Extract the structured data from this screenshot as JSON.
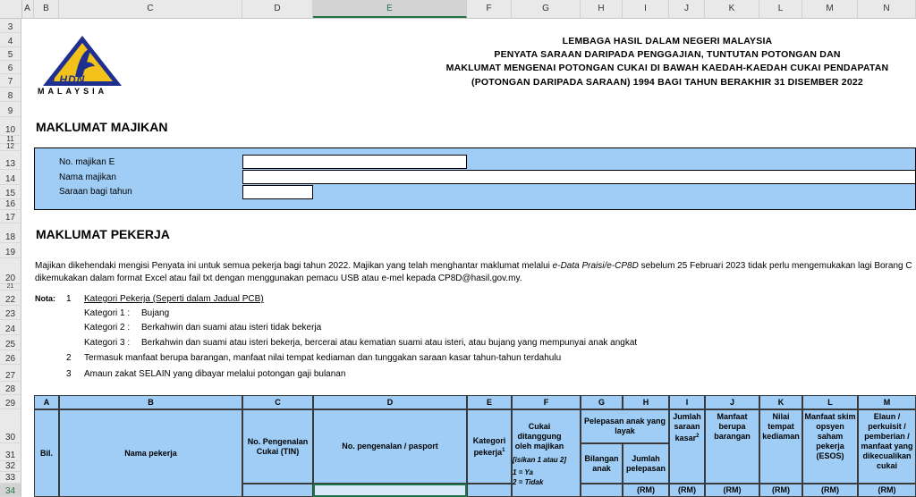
{
  "columns": [
    "A",
    "B",
    "C",
    "D",
    "E",
    "F",
    "G",
    "H",
    "I",
    "J",
    "K",
    "L",
    "M",
    "N"
  ],
  "rows": [
    "3",
    "4",
    "5",
    "6",
    "7",
    "8",
    "9",
    "10",
    "11",
    "12",
    "13",
    "14",
    "15",
    "16",
    "17",
    "18",
    "19",
    "20",
    "21",
    "22",
    "23",
    "24",
    "25",
    "26",
    "27",
    "28",
    "29",
    "30",
    "31",
    "32",
    "33",
    "34"
  ],
  "logo": {
    "text": "LHDN",
    "sub": "MALAYSIA"
  },
  "title": {
    "line1": "LEMBAGA HASIL DALAM NEGERI MALAYSIA",
    "line2": "PENYATA SARAAN DARIPADA PENGGAJIAN, TUNTUTAN POTONGAN DAN",
    "line3": "MAKLUMAT MENGENAI POTONGAN CUKAI DI BAWAH KAEDAH-KAEDAH CUKAI PENDAPATAN",
    "line4": "(POTONGAN DARIPADA SARAAN) 1994 BAGI TAHUN BERAKHIR 31 DISEMBER 2022"
  },
  "employer": {
    "heading": "MAKLUMAT MAJIKAN",
    "field_no": "No. majikan E",
    "field_name": "Nama majikan",
    "field_year": "Saraan bagi tahun"
  },
  "employee": {
    "heading": "MAKLUMAT PEKERJA",
    "intro_a": "Majikan dikehendaki mengisi Penyata ini untuk semua pekerja bagi tahun 2022. Majikan yang telah menghantar maklumat melalui ",
    "intro_italic": "e-Data Praisi/e-CP8D",
    "intro_b": " sebelum 25 Februari 2023 tidak perlu mengemukakan lagi Borang C",
    "intro_line2": "dikemukakan dalam format Excel atau fail txt dengan menggunakan pemacu USB atau e-mel kepada CP8D@hasil.gov.my."
  },
  "notes": {
    "label": "Nota:",
    "n1": "1",
    "n1_text": "Kategori Pekerja (Seperti dalam Jadual PCB)",
    "k1": "Kategori 1 :",
    "k1_text": "Bujang",
    "k2": "Kategori 2 :",
    "k2_text": "Berkahwin dan suami atau isteri tidak bekerja",
    "k3": "Kategori 3 :",
    "k3_text": "Berkahwin dan suami atau isteri bekerja, bercerai atau kematian suami atau isteri, atau bujang yang mempunyai anak angkat",
    "n2": "2",
    "n2_text": "Termasuk manfaat berupa barangan, manfaat nilai tempat kediaman dan tunggakan saraan kasar tahun-tahun terdahulu",
    "n3": "3",
    "n3_text": "Amaun zakat SELAIN yang dibayar melalui potongan gaji bulanan"
  },
  "table": {
    "letters": [
      "A",
      "B",
      "C",
      "D",
      "E",
      "F",
      "G",
      "H",
      "I",
      "J",
      "K",
      "L",
      "M"
    ],
    "bil": "Bil.",
    "nama": "Nama pekerja",
    "tin": "No. Pengenalan Cukai (TIN)",
    "pasport": "No. pengenalan / pasport",
    "kategori": "Kategori pekerja",
    "kategori_sup": "1",
    "cukai": "Cukai ditanggung oleh majikan",
    "cukai_note": "[isikan 1 atau 2]",
    "cukai_ya": "1 = Ya",
    "cukai_tidak": "2 = Tidak",
    "pelepasan": "Pelepasan anak yang layak",
    "bilangan": "Bilangan anak",
    "jumlah_pel": "Jumlah pelepasan",
    "saraan": "Jumlah saraan kasar",
    "saraan_sup": "2",
    "manfaat": "Manfaat berupa barangan",
    "tempat": "Nilai tempat kediaman",
    "esos": "Manfaat skim opsyen saham pekerja (ESOS)",
    "elaun": "Elaun / perkuisit / pemberian / manfaat yang dikecualikan cukai",
    "rm": "(RM)"
  }
}
